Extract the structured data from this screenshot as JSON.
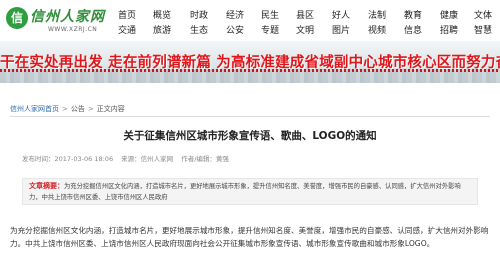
{
  "site": {
    "logo_text": "信州人家网",
    "logo_mark": "信",
    "logo_url": "WWW.XZRJ.CN"
  },
  "nav": {
    "row1": [
      "首页",
      "概览",
      "时政",
      "经济",
      "民生",
      "县区",
      "好人",
      "法制",
      "教育",
      "健康",
      "文体"
    ],
    "row2": [
      "交通",
      "旅游",
      "生态",
      "公安",
      "专题",
      "文明",
      "图片",
      "视频",
      "信息",
      "招聘",
      "智慧"
    ]
  },
  "banner": {
    "slogan": "干在实处再出发  走在前列谱新篇  为高标准建成省域副中心城市核心区而努力奋斗"
  },
  "breadcrumb": {
    "home": "信州人家网首页",
    "section": "公告",
    "current": "正文内容"
  },
  "article": {
    "title": "关于征集信州区城市形象宣传语、歌曲、LOGO的通知",
    "meta": {
      "time": "发布时间：2017-03-06 18:06",
      "source": "来源：信州人家网",
      "editor": "作者/编辑：黄强"
    },
    "summary_label": "文章摘要：",
    "summary_text": "为充分挖掘信州区文化内涵，打造城市名片，更好地展示城市形象，提升信州知名度、美誉度，增强市民的自豪感、认同感，扩大信州对外影响力，中共上饶市信州区委、上饶市信州区人民政府",
    "body": "为充分挖掘信州区文化内涵，打造城市名片，更好地展示城市形象，提升信州知名度、美誉度，增强市民的自豪感、认同感，扩大信州对外影响力。中共上饶市信州区委、上饶市信州区人民政府现面向社会公开征集城市形象宣传语、城市形象宣传歌曲和城市形象LOGO。"
  }
}
